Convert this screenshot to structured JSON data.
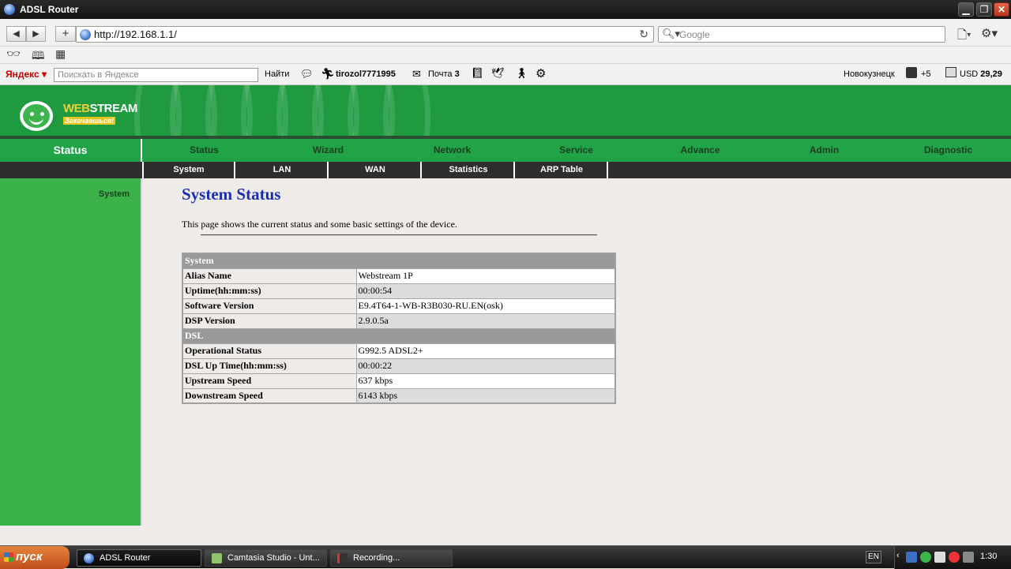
{
  "window": {
    "title": "ADSL Router"
  },
  "nav": {
    "url": "http://192.168.1.1/",
    "search_placeholder": "Google"
  },
  "yandex": {
    "logo": "Яндекс",
    "input_placeholder": "Поискать в Яндексе",
    "find_label": "Найти",
    "username": "tirozol7771995",
    "mail_label": "Почта",
    "mail_count": "3",
    "city": "Новокузнецк",
    "weather": "+5",
    "currency_label": "USD",
    "currency_value": "29,29"
  },
  "router": {
    "logo_main": "STREAM",
    "logo_prefix": "WEB",
    "logo_tagline": "Закачаешься!",
    "current_section": "Status",
    "main_tabs": [
      "Status",
      "Wizard",
      "Network",
      "Service",
      "Advance",
      "Admin",
      "Diagnostic"
    ],
    "sub_tabs": [
      "System",
      "LAN",
      "WAN",
      "Statistics",
      "ARP Table"
    ],
    "sidebar_item": "System",
    "page_title": "System Status",
    "description": "This page shows the current status and some basic settings of the device.",
    "table": {
      "system_header": "System",
      "system_rows": [
        {
          "label": "Alias Name",
          "value": "Webstream 1P"
        },
        {
          "label": "Uptime(hh:mm:ss)",
          "value": "00:00:54"
        },
        {
          "label": "Software Version",
          "value": "E9.4T64-1-WB-R3B030-RU.EN(osk)"
        },
        {
          "label": "DSP Version",
          "value": "2.9.0.5a"
        }
      ],
      "dsl_header": "DSL",
      "dsl_rows": [
        {
          "label": "Operational Status",
          "value": "G992.5 ADSL2+"
        },
        {
          "label": "DSL Up Time(hh:mm:ss)",
          "value": "00:00:22"
        },
        {
          "label": "Upstream Speed",
          "value": "637 kbps"
        },
        {
          "label": "Downstream Speed",
          "value": "6143 kbps"
        }
      ]
    }
  },
  "taskbar": {
    "start_label": "пуск",
    "tasks": [
      "ADSL Router",
      "Camtasia Studio - Unt...",
      "Recording..."
    ],
    "lang": "EN",
    "clock": "1:30"
  },
  "colors": {
    "banner_green": "#1f9a41",
    "nav_green": "#21a448",
    "sidebar_green": "#3bb34a",
    "title_blue": "#1c2fb0"
  }
}
